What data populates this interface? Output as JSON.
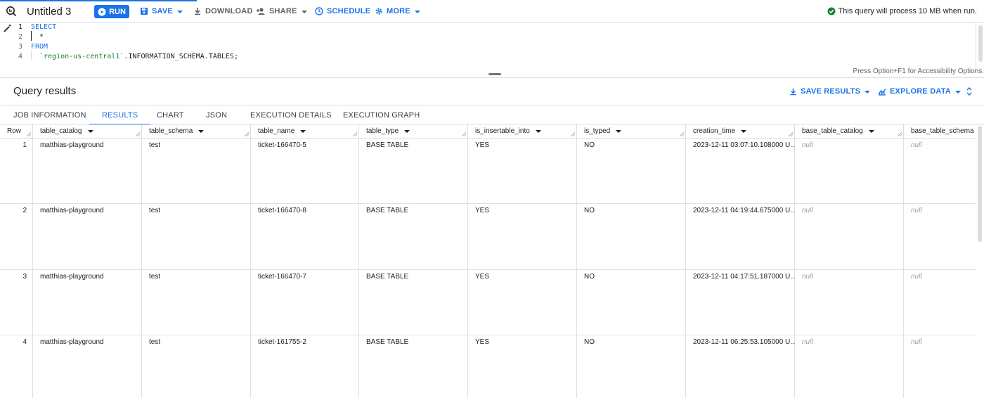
{
  "toolbar": {
    "title": "Untitled 3",
    "run_label": "RUN",
    "save_label": "SAVE",
    "download_label": "DOWNLOAD",
    "share_label": "SHARE",
    "schedule_label": "SCHEDULE",
    "more_label": "MORE",
    "status_text": "This query will process 10 MB when run."
  },
  "editor": {
    "line_numbers": [
      "1",
      "2",
      "3",
      "4"
    ],
    "line1": "SELECT",
    "line2": "  *",
    "line3": "FROM",
    "line4_table": "`region-us-central1`",
    "line4_rest": ".INFORMATION_SCHEMA.TABLES;",
    "accessibility_hint": "Press Option+F1 for Accessibility Options."
  },
  "results": {
    "title": "Query results",
    "save_results_label": "SAVE RESULTS",
    "explore_data_label": "EXPLORE DATA",
    "tabs": [
      "JOB INFORMATION",
      "RESULTS",
      "CHART",
      "JSON",
      "EXECUTION DETAILS",
      "EXECUTION GRAPH"
    ],
    "active_tab": "RESULTS",
    "columns": [
      "Row",
      "table_catalog",
      "table_schema",
      "table_name",
      "table_type",
      "is_insertable_into",
      "is_typed",
      "creation_time",
      "base_table_catalog",
      "base_table_schema"
    ],
    "rows": [
      [
        "1",
        "matthias-playground",
        "test",
        "ticket-166470-5",
        "BASE TABLE",
        "YES",
        "NO",
        "2023-12-11 03:07:10.108000 U...",
        "null",
        "null"
      ],
      [
        "2",
        "matthias-playground",
        "test",
        "ticket-166470-8",
        "BASE TABLE",
        "YES",
        "NO",
        "2023-12-11 04:19:44.675000 U...",
        "null",
        "null"
      ],
      [
        "3",
        "matthias-playground",
        "test",
        "ticket-166470-7",
        "BASE TABLE",
        "YES",
        "NO",
        "2023-12-11 04:17:51.187000 U...",
        "null",
        "null"
      ],
      [
        "4",
        "matthias-playground",
        "test",
        "ticket-161755-2",
        "BASE TABLE",
        "YES",
        "NO",
        "2023-12-11 06:25:53.105000 U...",
        "null",
        "null"
      ]
    ]
  },
  "colors": {
    "accent": "#1a73e8",
    "success": "#188038",
    "null_text": "#9aa0a6"
  }
}
